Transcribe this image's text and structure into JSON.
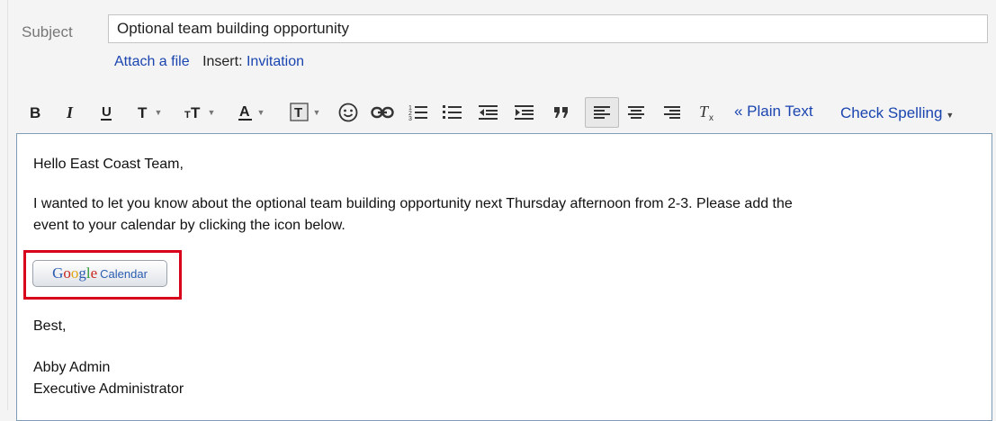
{
  "subject": {
    "label": "Subject",
    "value": "Optional team building opportunity"
  },
  "attach": {
    "link": "Attach a file",
    "insert_label": "Insert:",
    "invitation_link": "Invitation"
  },
  "toolbar": {
    "buttons": [
      "bold-icon",
      "italic-icon",
      "underline-icon",
      "font-icon",
      "font-size-icon",
      "text-color-icon",
      "highlight-color-icon",
      "emoji-icon",
      "link-icon",
      "numbered-list-icon",
      "bulleted-list-icon",
      "outdent-icon",
      "indent-icon",
      "quote-icon",
      "align-left-icon",
      "align-center-icon",
      "align-right-icon",
      "remove-formatting-icon"
    ],
    "plain_text": "« Plain Text",
    "check_spelling": "Check Spelling"
  },
  "body": {
    "greeting": "Hello East Coast Team,",
    "line1": "I wanted to let you know about the optional team building opportunity next Thursday afternoon from 2-3. Please add the",
    "line2": "event to your calendar by clicking the icon below.",
    "calendar_button": {
      "google": [
        "G",
        "o",
        "o",
        "g",
        "l",
        "e"
      ],
      "calendar": "Calendar"
    },
    "signoff": "Best,",
    "name": "Abby Admin",
    "title": "Executive Administrator"
  },
  "colors": {
    "link": "#1a45b0",
    "highlight": "#d9001b",
    "border": "#7f9db9"
  }
}
